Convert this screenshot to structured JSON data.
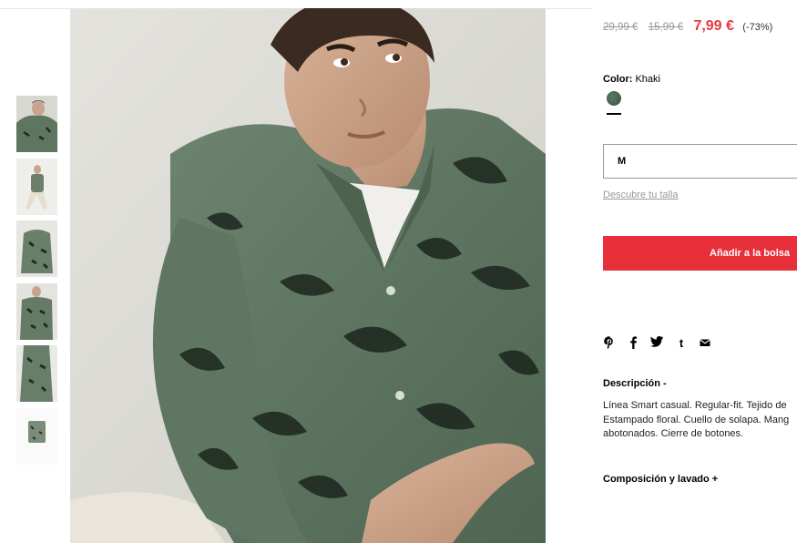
{
  "product": {
    "prices": {
      "original": "29,99 €",
      "previous": "15,99 €",
      "current": "7,99 €",
      "discount": "(-73%)"
    },
    "color": {
      "label": "Color:",
      "value": "Khaki"
    },
    "size": {
      "selected": "M"
    },
    "size_guide_link": "Descubre tu talla",
    "add_to_bag_label": "Añadir a la bolsa",
    "share_icons": [
      "pinterest-icon",
      "facebook-icon",
      "twitter-icon",
      "tumblr-icon",
      "email-icon"
    ],
    "description": {
      "title": "Descripción -",
      "lines": [
        "Línea Smart casual. Regular-fit. Tejido de",
        "Estampado floral. Cuello de solapa. Mang",
        "abotonados. Cierre de botones."
      ]
    },
    "composition_title": "Composición y lavado +"
  },
  "colors": {
    "accent": "#e8303b",
    "price_sale": "#e53945",
    "muted": "#999999",
    "shirt": "#5e7560"
  }
}
